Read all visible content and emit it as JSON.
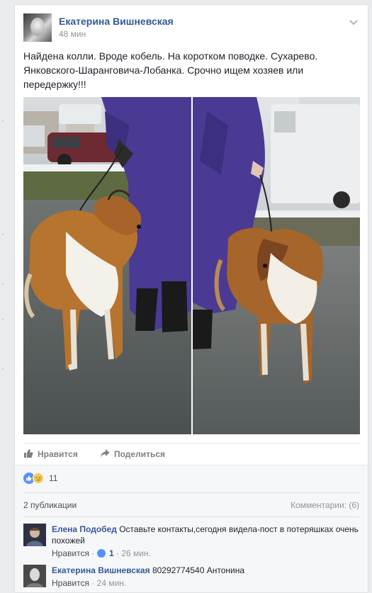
{
  "post": {
    "author": "Екатерина Вишневская",
    "time": "48 мин",
    "text": "Найдена колли. Вроде кобель. На коротком поводке. Сухарево. Янковского-Шаранговича-Лобанка. Срочно ищем хозяев или передержку!!!"
  },
  "actions": {
    "like_label": "Нравится",
    "share_label": "Поделиться"
  },
  "reactions": {
    "count": "11",
    "icons": [
      "like-reaction-icon",
      "sad-reaction-icon"
    ]
  },
  "feedback": {
    "shares_label": "2 публикации",
    "comments_label": "Комментарии: (6)"
  },
  "comments": [
    {
      "author": "Елена Подобед",
      "text": "Оставьте контакты,сегодня видела-пост в потеряшках очень похожей",
      "like_label": "Нравится",
      "likes": "1",
      "time": "26 мин."
    },
    {
      "author": "Екатерина Вишневская",
      "text": "80292774540 Антонина",
      "like_label": "Нравится",
      "time": "24 мин."
    }
  ],
  "colors": {
    "link": "#365899",
    "muted": "#90949c",
    "like_blue": "#5890ff",
    "coat": "#4a3a94"
  }
}
